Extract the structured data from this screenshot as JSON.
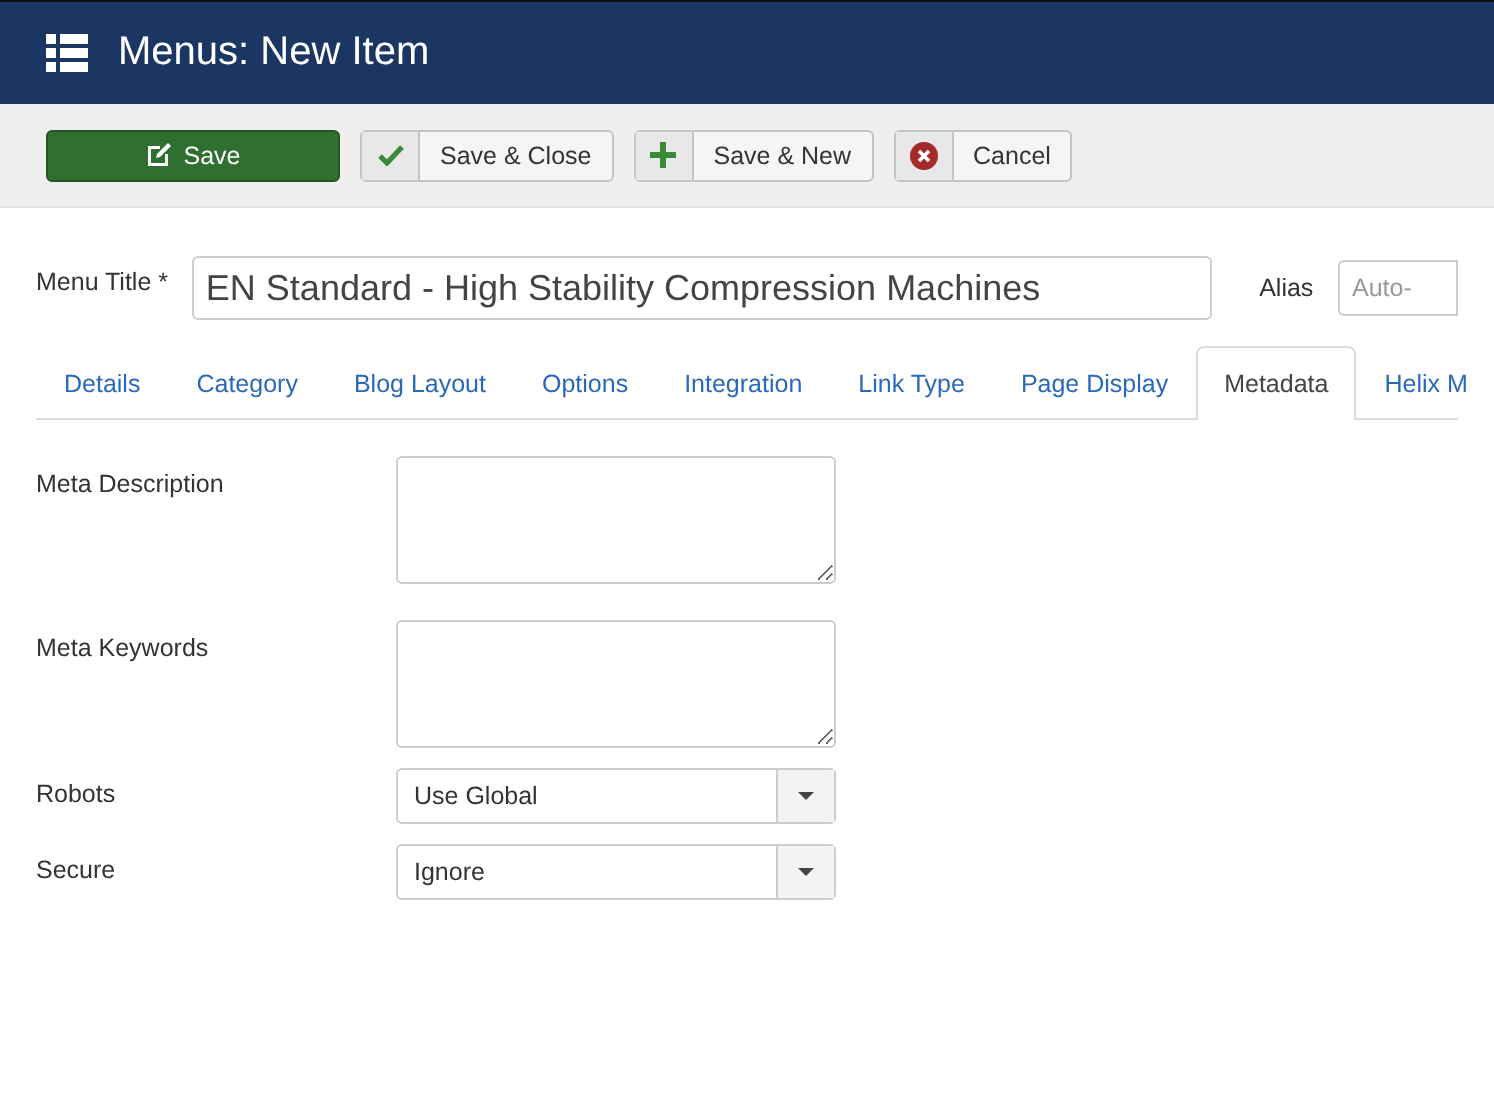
{
  "header": {
    "title": "Menus: New Item"
  },
  "toolbar": [
    {
      "kind": "save",
      "label": "Save"
    },
    {
      "kind": "check",
      "label": "Save & Close"
    },
    {
      "kind": "plus",
      "label": "Save & New"
    },
    {
      "kind": "cancel",
      "label": "Cancel"
    }
  ],
  "title_field": {
    "label": "Menu Title *",
    "value": "EN Standard - High Stability Compression Machines"
  },
  "alias_field": {
    "label": "Alias",
    "placeholder": "Auto-"
  },
  "tabs": [
    {
      "label": "Details",
      "selected": false
    },
    {
      "label": "Category",
      "selected": false
    },
    {
      "label": "Blog Layout",
      "selected": false
    },
    {
      "label": "Options",
      "selected": false
    },
    {
      "label": "Integration",
      "selected": false
    },
    {
      "label": "Link Type",
      "selected": false
    },
    {
      "label": "Page Display",
      "selected": false
    },
    {
      "label": "Metadata",
      "selected": true
    },
    {
      "label": "Helix M",
      "selected": false
    }
  ],
  "fields": [
    {
      "kind": "textarea",
      "label": "Meta Description"
    },
    {
      "kind": "textarea",
      "label": "Meta Keywords"
    },
    {
      "kind": "select",
      "label": "Robots",
      "value": "Use Global"
    },
    {
      "kind": "select",
      "label": "Secure",
      "value": "Ignore"
    }
  ]
}
